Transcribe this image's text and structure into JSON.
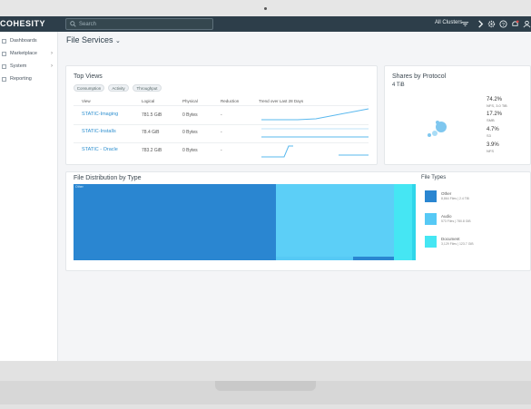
{
  "app": {
    "logo": "COHESITY"
  },
  "topbar": {
    "search_placeholder": "Search",
    "cluster_label": "All Clusters"
  },
  "sidebar": {
    "items": [
      {
        "label": "Dashboards",
        "has_submenu": false
      },
      {
        "label": "Marketplace",
        "has_submenu": true
      },
      {
        "label": "System",
        "has_submenu": true
      },
      {
        "label": "Reporting",
        "has_submenu": false
      }
    ]
  },
  "page": {
    "title": "File Services"
  },
  "top_views": {
    "title": "Top Views",
    "chips": [
      "Consumption",
      "Activity",
      "Throughput"
    ],
    "columns": [
      "View",
      "Logical",
      "Physical",
      "Reduction",
      "Trend over Last 28 Days"
    ],
    "rows": [
      {
        "view": "STATIC-Imaging",
        "logical": "781.5 GiB",
        "physical": "0 Bytes",
        "reduction": "-"
      },
      {
        "view": "STATIC-Installs",
        "logical": "78.4 GiB",
        "physical": "0 Bytes",
        "reduction": "-"
      },
      {
        "view": "STATIC - Oracle",
        "logical": "783.2 GiB",
        "physical": "0 Bytes",
        "reduction": "-"
      }
    ]
  },
  "shares": {
    "title": "Shares by Protocol",
    "total": "4 TiB",
    "items": [
      {
        "pct": "74.2%",
        "label": "NFS, 3.0 TiB"
      },
      {
        "pct": "17.2%",
        "label": "SMB"
      },
      {
        "pct": "4.7%",
        "label": "S3"
      },
      {
        "pct": "3.9%",
        "label": "NFS"
      }
    ]
  },
  "distribution": {
    "title": "File Distribution by Type",
    "corner_label": "Other",
    "legend_title": "File Types",
    "legend": [
      {
        "name": "Other",
        "detail": "8,864 Files | 2.4 TiB",
        "color": "#2a86d1"
      },
      {
        "name": "Audio",
        "detail": "573 Files | 780.8 GiB",
        "color": "#56c9f5"
      },
      {
        "name": "Document",
        "detail": "3,129 Files | 123.7 GiB",
        "color": "#45e6f3"
      }
    ]
  },
  "colors": {
    "topbar": "#2d3e4a",
    "link": "#2d8fcf",
    "accent": "#2a86d1"
  }
}
